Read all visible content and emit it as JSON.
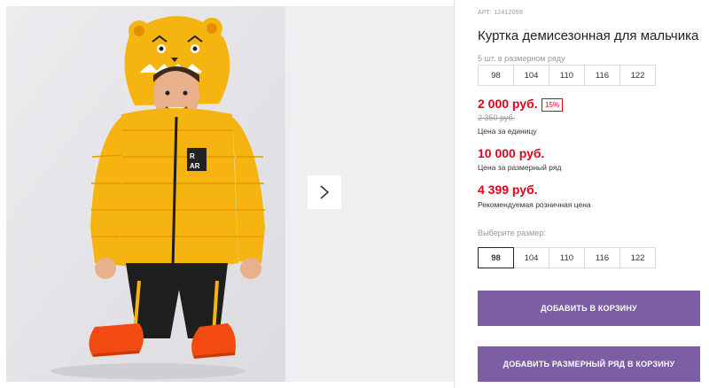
{
  "product": {
    "article": "АРТ: 12412059",
    "title": "Куртка демисезонная для мальчика"
  },
  "pack": {
    "label": "5 шт. в размерном ряду",
    "sizes": [
      "98",
      "104",
      "110",
      "116",
      "122"
    ]
  },
  "prices": {
    "current": "2 000 руб.",
    "discount": "15%",
    "old": "2 350 руб.",
    "unit_label": "Цена за единицу",
    "set_price": "10 000 руб.",
    "set_label": "Цена за размерный ряд",
    "rrp": "4 399 руб.",
    "rrp_label": "Рекомендуемая розничная цена"
  },
  "size_picker": {
    "label": "Выберите размер:",
    "sizes": [
      "98",
      "104",
      "110",
      "116",
      "122"
    ],
    "selected": "98"
  },
  "buttons": {
    "add_to_cart": "ДОБАВИТЬ В КОРЗИНУ",
    "add_set_to_cart": "ДОБАВИТЬ РАЗМЕРНЫЙ РЯД В КОРЗИНУ"
  },
  "photo_badge": "R AR",
  "colors": {
    "accent_red": "#e0001b",
    "button_purple": "#7c5ea5",
    "jacket_yellow": "#f5b40f"
  },
  "icons": {
    "next": "chevron-right-icon"
  }
}
